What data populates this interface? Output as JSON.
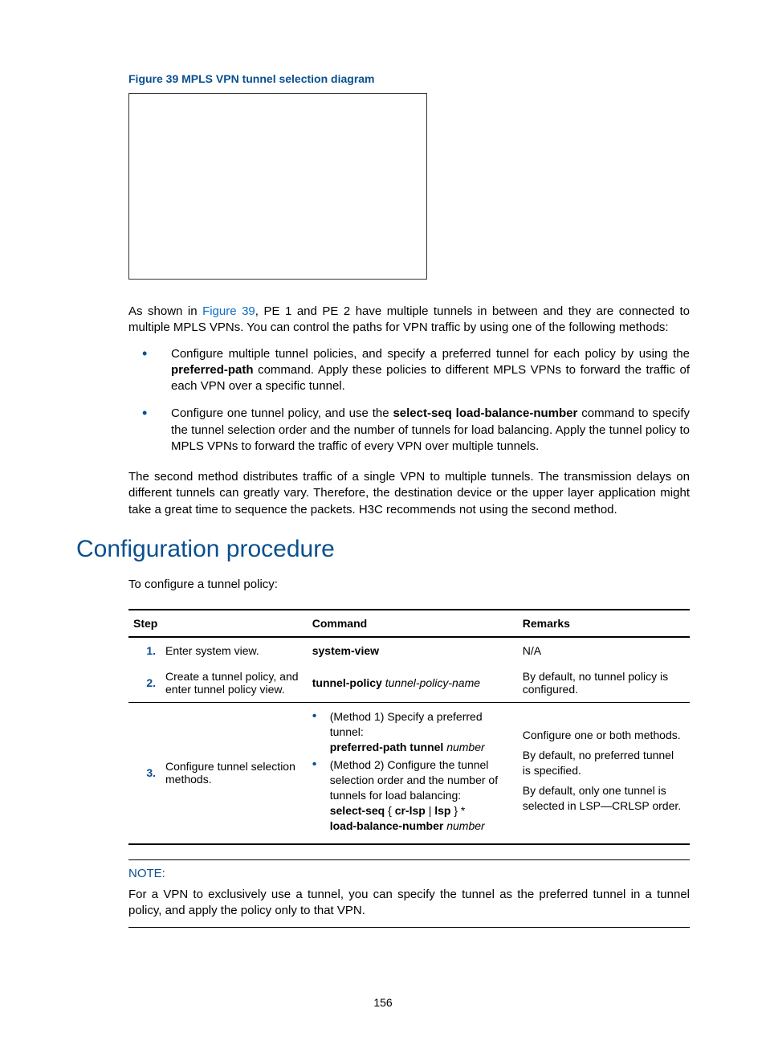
{
  "figure": {
    "caption": "Figure 39 MPLS VPN tunnel selection diagram"
  },
  "para1": {
    "prefix": "As shown in ",
    "link": "Figure 39",
    "suffix": ", PE 1 and PE 2 have multiple tunnels in between and they are connected to multiple MPLS VPNs. You can control the paths for VPN traffic by using one of the following methods:"
  },
  "bullets": [
    {
      "pre": "Configure multiple tunnel policies, and specify a preferred tunnel for each policy by using the ",
      "bold": "preferred-path",
      "post": " command. Apply these policies to different MPLS VPNs to forward the traffic of each VPN over a specific tunnel."
    },
    {
      "pre": "Configure one tunnel policy, and use the ",
      "bold": "select-seq load-balance-number",
      "post": " command to specify the tunnel selection order and the number of tunnels for load balancing. Apply the tunnel policy to MPLS VPNs to forward the traffic of every VPN over multiple tunnels."
    }
  ],
  "para2": "The second method distributes traffic of a single VPN to multiple tunnels. The transmission delays on different tunnels can greatly vary. Therefore, the destination device or the upper layer application might take a great time to sequence the packets. H3C recommends not using the second method.",
  "section_title": "Configuration procedure",
  "intro": "To configure a tunnel policy:",
  "table": {
    "head": {
      "step": "Step",
      "command": "Command",
      "remarks": "Remarks"
    },
    "rows": [
      {
        "num": "1.",
        "step": "Enter system view.",
        "command_bold": "system-view",
        "remarks_plain": "N/A"
      },
      {
        "num": "2.",
        "step": "Create a tunnel policy, and enter tunnel policy view.",
        "command_bold": "tunnel-policy",
        "command_italic": " tunnel-policy-name",
        "remarks_plain": "By default, no tunnel policy is configured."
      },
      {
        "num": "3.",
        "step": "Configure tunnel selection methods.",
        "methods": [
          {
            "label": "(Method 1) Specify a preferred tunnel:",
            "cmd_b1": "preferred-path tunnel",
            "cmd_i1": " number"
          },
          {
            "label": "(Method 2) Configure the tunnel selection order and the number of tunnels for load balancing:",
            "cmd_b1": "select-seq",
            "cmd_mid": " { ",
            "cmd_b2": "cr-lsp",
            "cmd_mid2": " | ",
            "cmd_b3": "lsp",
            "cmd_mid3": " } * ",
            "cmd_b4": "load-balance-number",
            "cmd_i1": " number"
          }
        ],
        "remarks_lines": [
          "Configure one or both methods.",
          "By default, no preferred tunnel is specified.",
          "By default, only one tunnel is selected in LSP—CRLSP order."
        ]
      }
    ]
  },
  "note": {
    "label": "NOTE:",
    "text": "For a VPN to exclusively use a tunnel, you can specify the tunnel as the preferred tunnel in a tunnel policy, and apply the policy only to that VPN."
  },
  "page_number": "156"
}
